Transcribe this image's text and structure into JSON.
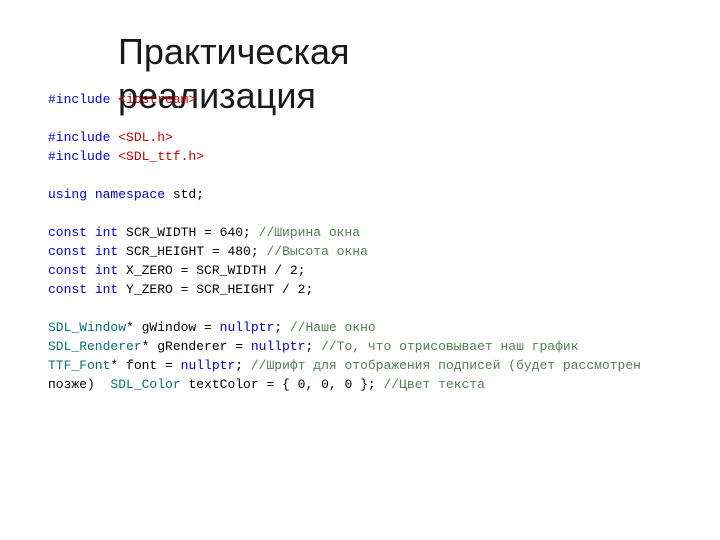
{
  "title": "Практическая\nреализация",
  "code": [
    [
      {
        "cls": "kw",
        "t": "#include "
      },
      {
        "cls": "hdr",
        "t": "<iostream>"
      }
    ],
    [],
    [
      {
        "cls": "kw",
        "t": "#include "
      },
      {
        "cls": "hdr",
        "t": "<SDL.h>"
      }
    ],
    [
      {
        "cls": "kw",
        "t": "#include "
      },
      {
        "cls": "hdr",
        "t": "<SDL_ttf.h>"
      }
    ],
    [],
    [
      {
        "cls": "kw",
        "t": "using "
      },
      {
        "cls": "kw",
        "t": "namespace "
      },
      {
        "cls": "id",
        "t": "std;"
      }
    ],
    [],
    [
      {
        "cls": "kw",
        "t": "const "
      },
      {
        "cls": "kw",
        "t": "int "
      },
      {
        "cls": "id",
        "t": "SCR_WIDTH = 640; "
      },
      {
        "cls": "cmt",
        "t": "//Ширина окна"
      }
    ],
    [
      {
        "cls": "kw",
        "t": "const "
      },
      {
        "cls": "kw",
        "t": "int "
      },
      {
        "cls": "id",
        "t": "SCR_HEIGHT = 480; "
      },
      {
        "cls": "cmt",
        "t": "//Высота окна"
      }
    ],
    [
      {
        "cls": "kw",
        "t": "const "
      },
      {
        "cls": "kw",
        "t": "int "
      },
      {
        "cls": "id",
        "t": "X_ZERO = SCR_WIDTH / 2;"
      }
    ],
    [
      {
        "cls": "kw",
        "t": "const "
      },
      {
        "cls": "kw",
        "t": "int "
      },
      {
        "cls": "id",
        "t": "Y_ZERO = SCR_HEIGHT / 2;"
      }
    ],
    [],
    [
      {
        "cls": "type",
        "t": "SDL_Window"
      },
      {
        "cls": "id",
        "t": "* gWindow = "
      },
      {
        "cls": "kw",
        "t": "nullptr"
      },
      {
        "cls": "id",
        "t": "; "
      },
      {
        "cls": "cmt",
        "t": "//Наше окно"
      }
    ],
    [
      {
        "cls": "type",
        "t": "SDL_Renderer"
      },
      {
        "cls": "id",
        "t": "* gRenderer = "
      },
      {
        "cls": "kw",
        "t": "nullptr"
      },
      {
        "cls": "id",
        "t": "; "
      },
      {
        "cls": "cmt",
        "t": "//То, что отрисовывает наш график"
      }
    ],
    [
      {
        "cls": "type",
        "t": "TTF_Font"
      },
      {
        "cls": "id",
        "t": "* font = "
      },
      {
        "cls": "kw",
        "t": "nullptr"
      },
      {
        "cls": "id",
        "t": "; "
      },
      {
        "cls": "cmt",
        "t": "//Шрифт для отображения подписей (будет рассмотрен"
      }
    ],
    [
      {
        "cls": "id",
        "t": "позже)  "
      },
      {
        "cls": "type",
        "t": "SDL_Color"
      },
      {
        "cls": "id",
        "t": " textColor = { 0, 0, 0 }; "
      },
      {
        "cls": "cmt",
        "t": "//Цвет текста"
      }
    ]
  ]
}
